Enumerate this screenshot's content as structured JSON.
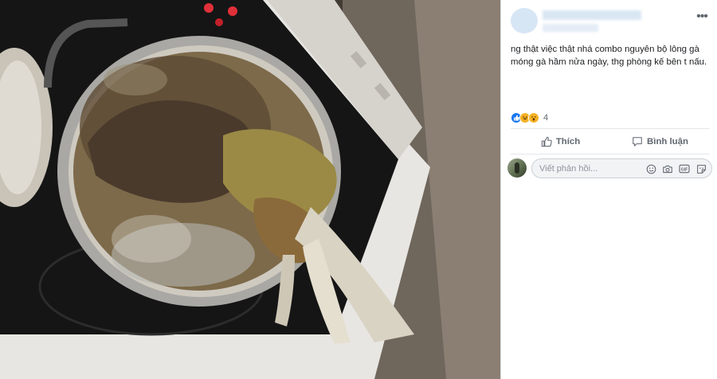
{
  "post": {
    "text_lines": [
      "ng thật việc thật nhá combo nguyên bộ lông gà",
      "móng gà hầm nửa ngày, thg phòng kế bên t nấu."
    ],
    "reactions": {
      "types": [
        "like",
        "haha",
        "wow"
      ],
      "count": "4"
    },
    "actions": {
      "like_label": "Thích",
      "comment_label": "Bình luận"
    },
    "comment_input": {
      "placeholder": "Viết phản hồi..."
    },
    "more_label": "•••"
  },
  "colors": {
    "accent": "#1877f2",
    "reaction_yellow": "#f7b125",
    "secondary_text": "#606770",
    "divider": "#e4e6eb"
  },
  "icons": {
    "like": "thumbs-up-icon",
    "comment": "speech-bubble-icon",
    "input_icons": [
      "emoji-icon",
      "camera-icon",
      "gif-icon",
      "sticker-icon"
    ]
  }
}
